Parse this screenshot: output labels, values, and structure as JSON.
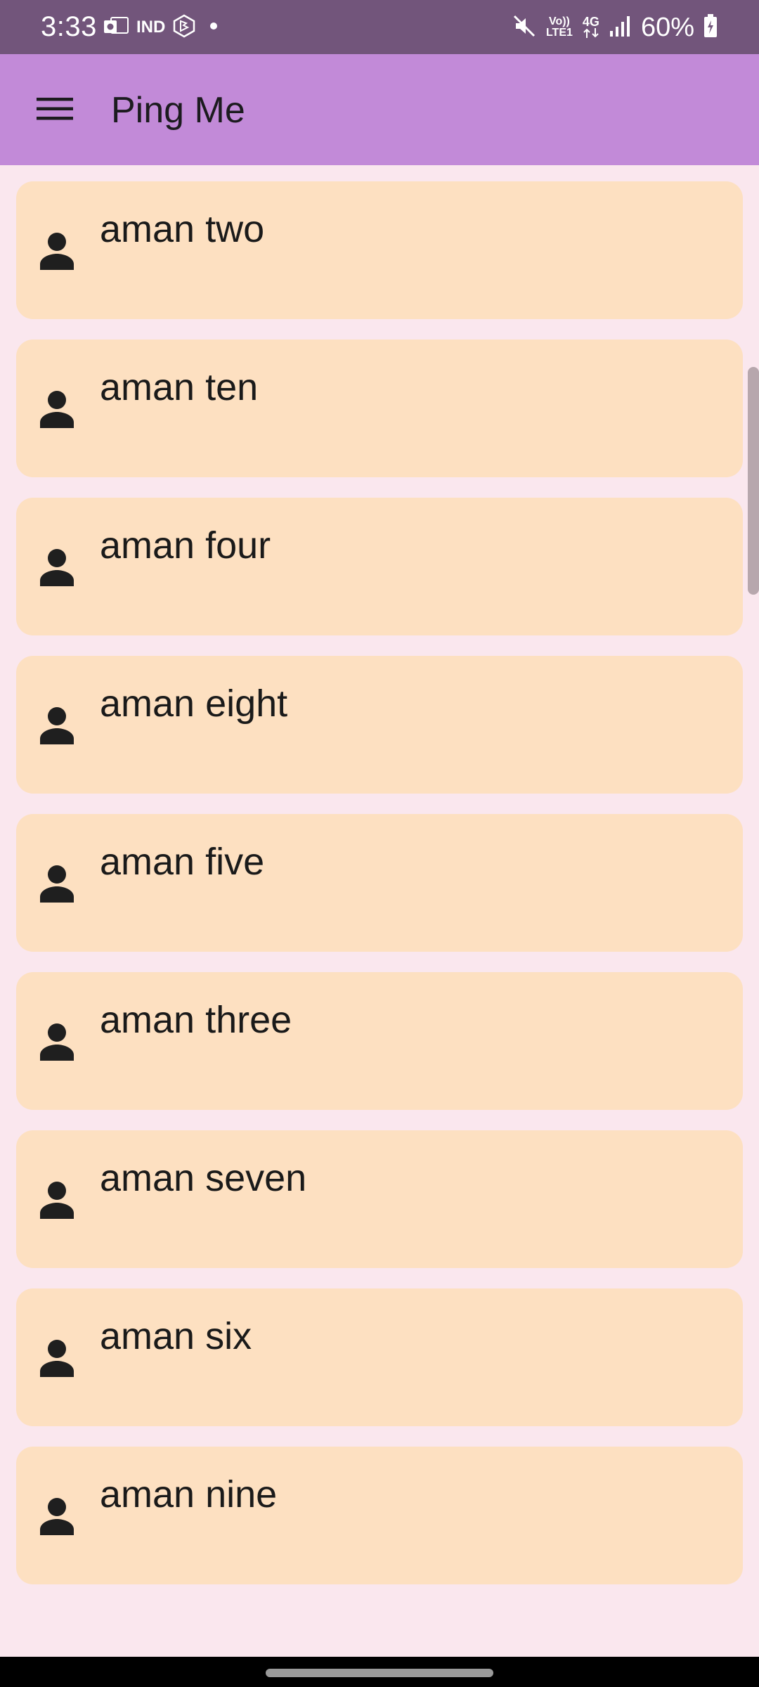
{
  "status_bar": {
    "time": "3:33",
    "carrier_badge": "IND",
    "volte_label": "Vo)) LTE1",
    "network_label": "4G",
    "battery": "60%",
    "icons": [
      "outlook-icon",
      "carrier-icon",
      "bing-icon",
      "notification-dot-icon",
      "mute-icon",
      "volte-icon",
      "4g-data-icon",
      "signal-icon",
      "battery-icon"
    ]
  },
  "app_bar": {
    "title": "Ping Me",
    "menu_icon": "hamburger-menu-icon",
    "background": "#c28ad8"
  },
  "contacts": [
    {
      "name": "aman two",
      "icon": "person-icon"
    },
    {
      "name": "aman ten",
      "icon": "person-icon"
    },
    {
      "name": "aman four",
      "icon": "person-icon"
    },
    {
      "name": "aman eight",
      "icon": "person-icon"
    },
    {
      "name": "aman five",
      "icon": "person-icon"
    },
    {
      "name": "aman three",
      "icon": "person-icon"
    },
    {
      "name": "aman seven",
      "icon": "person-icon"
    },
    {
      "name": "aman six",
      "icon": "person-icon"
    },
    {
      "name": "aman nine",
      "icon": "person-icon"
    }
  ],
  "colors": {
    "status_bar": "#72557b",
    "page_background": "#fae7ee",
    "card_background": "#fde0c1",
    "text": "#1a1a1a"
  }
}
